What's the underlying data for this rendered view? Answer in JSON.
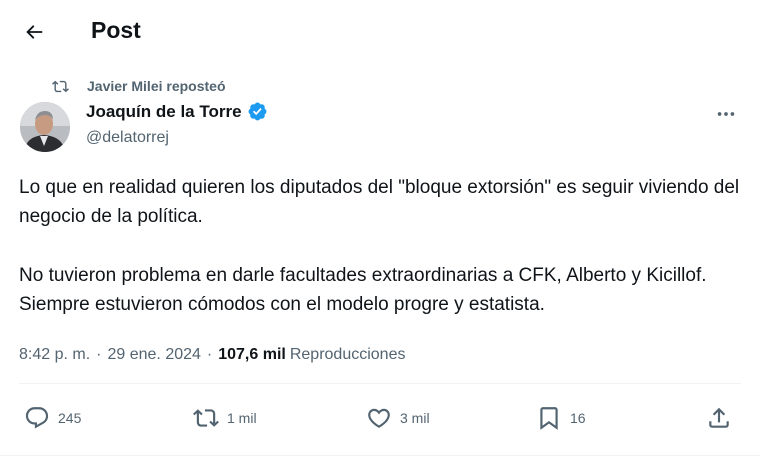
{
  "header": {
    "title": "Post",
    "back_icon": "arrow-left-icon"
  },
  "repost": {
    "text": "Javier Milei reposteó",
    "icon": "repost-icon"
  },
  "author": {
    "name": "Joaquín de la Torre",
    "handle": "@delatorrej",
    "verified": true,
    "verified_color": "#1d9bf0",
    "avatar": "avatar-photo"
  },
  "post": {
    "paragraphs": [
      "Lo que en realidad quieren los diputados del \"bloque extorsión\" es seguir viviendo del negocio de la política.",
      "No tuvieron problema en darle facultades extraordinarias a CFK, Alberto y Kicillof. Siempre estuvieron cómodos con el modelo progre y estatista."
    ]
  },
  "meta": {
    "time": "8:42 p. m.",
    "sep1": "·",
    "date": "29 ene. 2024",
    "sep2": "·",
    "views_count": "107,6 mil",
    "views_label": "Reproducciones"
  },
  "actions": {
    "replies": "245",
    "reposts": "1 mil",
    "likes": "3 mil",
    "bookmarks": "16"
  },
  "colors": {
    "text": "#0f1419",
    "secondary": "#536471",
    "accent": "#1d9bf0",
    "divider": "#eff3f4"
  }
}
